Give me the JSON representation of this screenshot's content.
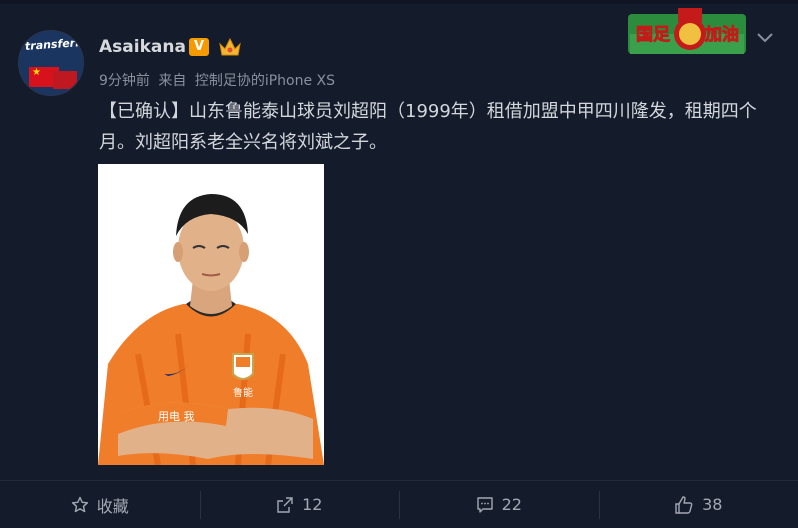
{
  "post": {
    "username": "Asaikana",
    "verified_badge": "V",
    "avatar_logo_text": "transfermarkt",
    "meta": {
      "time": "9分钟前",
      "source_prefix": "来自",
      "source": "控制足协的iPhone XS"
    },
    "content": "【已确认】山东鲁能泰山球员刘超阳（1999年）租借加盟中甲四川隆发，租期四个月。刘超阳系老全兴名将刘斌之子。",
    "topic_badge": "国足加油",
    "photo": {
      "description_icon": "player-photo",
      "shirt_text": "鲁能"
    }
  },
  "actions": {
    "favorite": {
      "label": "收藏",
      "icon": "star-icon"
    },
    "repost": {
      "label": "12",
      "icon": "share-icon"
    },
    "comment": {
      "label": "22",
      "icon": "comment-icon"
    },
    "like": {
      "label": "38",
      "icon": "thumbs-up-icon"
    }
  },
  "colors": {
    "background": "#141c2c",
    "text": "#d3d6db",
    "meta": "#8a909b",
    "vip_orange": "#f59a00"
  }
}
